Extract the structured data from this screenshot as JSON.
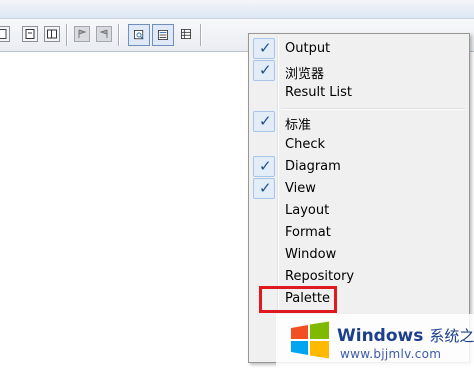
{
  "toolbar": {
    "buttons": [
      {
        "icon": "page-icon"
      },
      {
        "icon": "page-icon"
      },
      {
        "icon": "double-page-icon"
      },
      {
        "icon": "flag-icon"
      },
      {
        "icon": "flag-icon"
      },
      {
        "icon": "search-window-icon",
        "active": true
      },
      {
        "icon": "list-window-icon",
        "active": true
      },
      {
        "icon": "table-icon"
      }
    ]
  },
  "menu": {
    "items": [
      {
        "label": "Output",
        "checked": true
      },
      {
        "label": "浏览器",
        "checked": true
      },
      {
        "label": "Result List",
        "checked": false
      },
      {
        "label": "标准",
        "checked": true
      },
      {
        "label": "Check",
        "checked": false
      },
      {
        "label": "Diagram",
        "checked": true
      },
      {
        "label": "View",
        "checked": true
      },
      {
        "label": "Layout",
        "checked": false
      },
      {
        "label": "Format",
        "checked": false
      },
      {
        "label": "Window",
        "checked": false
      },
      {
        "label": "Repository",
        "checked": false
      },
      {
        "label": "Palette",
        "checked": false,
        "highlighted": true
      }
    ],
    "check_glyph": "✓"
  },
  "colors": {
    "highlight_border": "#e0191f",
    "check_bg": "#e3edf8",
    "watermark_blue": "#1c3f8c"
  },
  "watermark": {
    "title": "Windows",
    "subtitle": "系统之家",
    "url": "www.bjjmlv.com"
  }
}
